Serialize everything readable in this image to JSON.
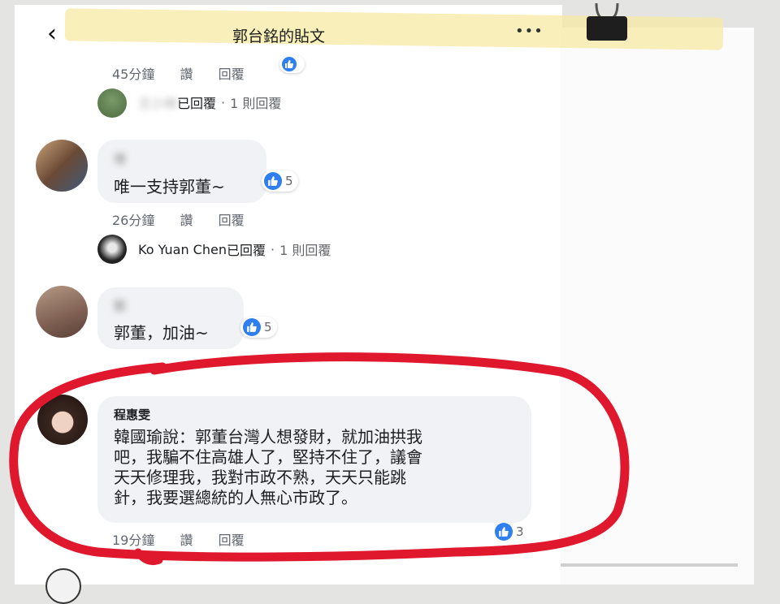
{
  "header": {
    "back_icon": "‹",
    "title": "郭台銘的貼文",
    "more_icon": "•••"
  },
  "comments": [
    {
      "meta": {
        "time": "45分鐘",
        "like": "讚",
        "reply": "回覆"
      },
      "reply_summary": {
        "name": "王小林",
        "action": "已回覆",
        "count": "1 則回覆"
      }
    },
    {
      "author": "增",
      "text": "唯一支持郭董~",
      "reactions": "5",
      "meta": {
        "time": "26分鐘",
        "like": "讚",
        "reply": "回覆"
      },
      "reply_summary": {
        "name": "Ko Yuan Chen",
        "action": "已回覆",
        "count": "1 則回覆"
      }
    },
    {
      "author": "劉",
      "text": "郭董，加油~",
      "reactions": "5"
    },
    {
      "author": "程惠雯",
      "text_lines": [
        "韓國瑜說：郭董台灣人想發財，就加油拱我",
        "吧，我騙不住高雄人了，堅持不住了，議會",
        "天天修理我，我對市政不熟，天天只能跳",
        "針，我要選總統的人無心市政了。"
      ],
      "reactions": "3",
      "meta": {
        "time": "19分鐘",
        "like": "讚",
        "reply": "回覆"
      }
    }
  ],
  "colors": {
    "accent_like": "#2f7ff0",
    "highlight_marker": "#e0182d",
    "bubble": "#f0f2f5",
    "tape": "#f6e9a4"
  }
}
